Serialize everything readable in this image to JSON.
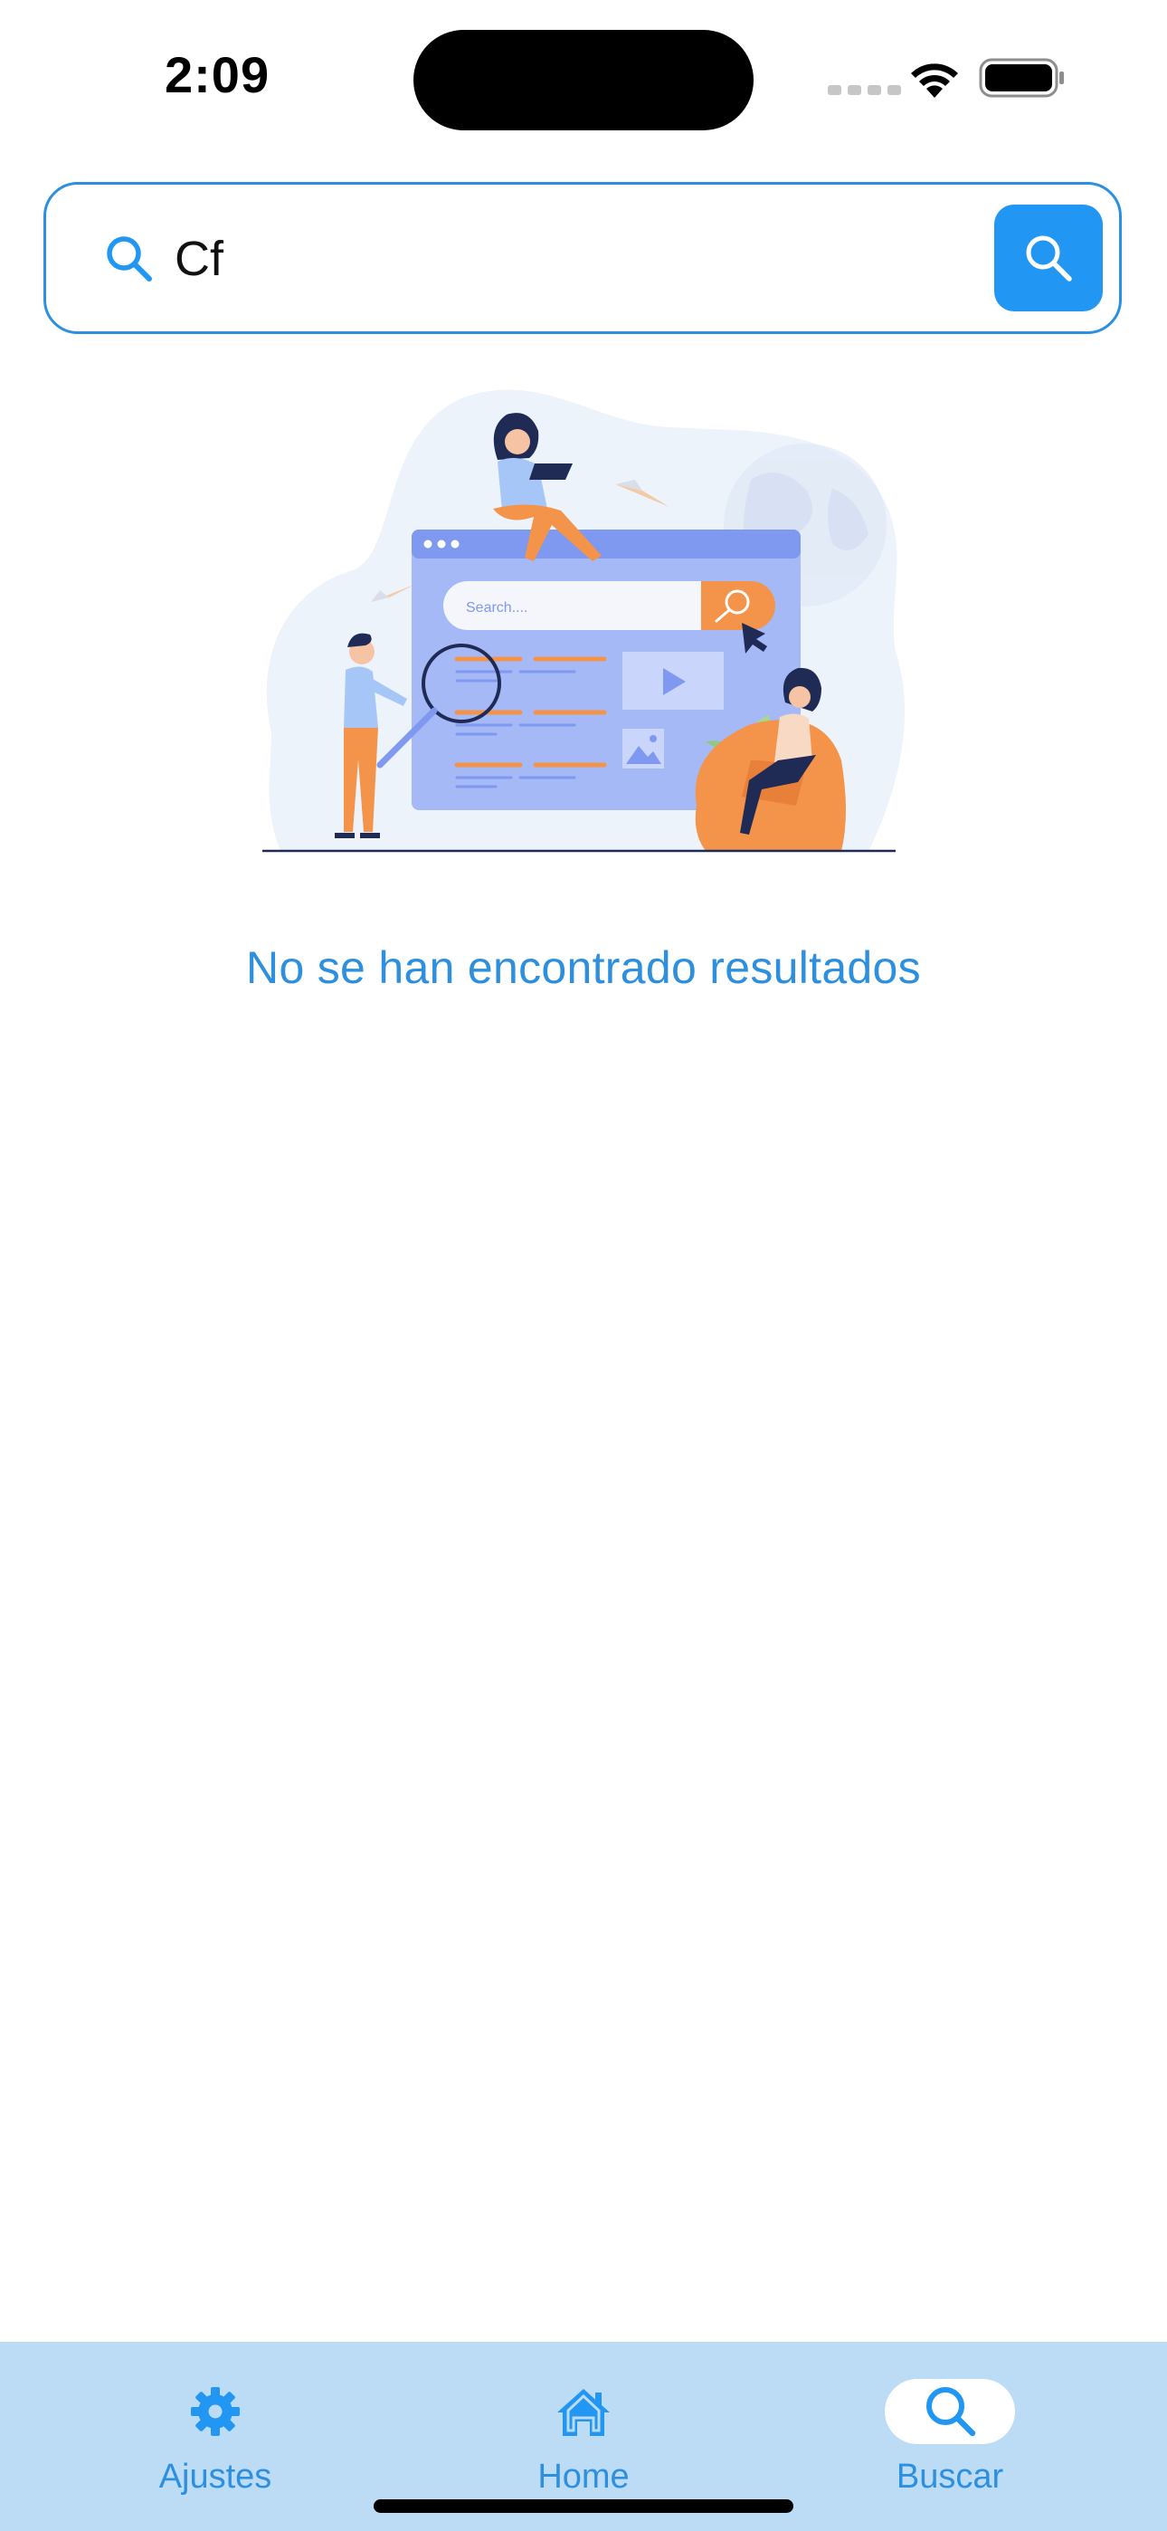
{
  "status_bar": {
    "time": "2:09"
  },
  "search": {
    "value": "Cf",
    "leading_icon": "search-icon",
    "button_icon": "search-icon"
  },
  "illustration": {
    "search_placeholder": "Search...."
  },
  "results": {
    "empty_message": "No se han encontrado resultados"
  },
  "bottom_nav": {
    "items": [
      {
        "label": "Ajustes",
        "icon": "gear-icon",
        "active": false
      },
      {
        "label": "Home",
        "icon": "home-icon",
        "active": false
      },
      {
        "label": "Buscar",
        "icon": "search-icon",
        "active": true
      }
    ]
  },
  "colors": {
    "accent": "#2196f3",
    "accent_text": "#2d8fdd",
    "nav_background": "#bcdcf6",
    "illustration_orange": "#f4934a",
    "illustration_blue": "#a6b9f7"
  }
}
